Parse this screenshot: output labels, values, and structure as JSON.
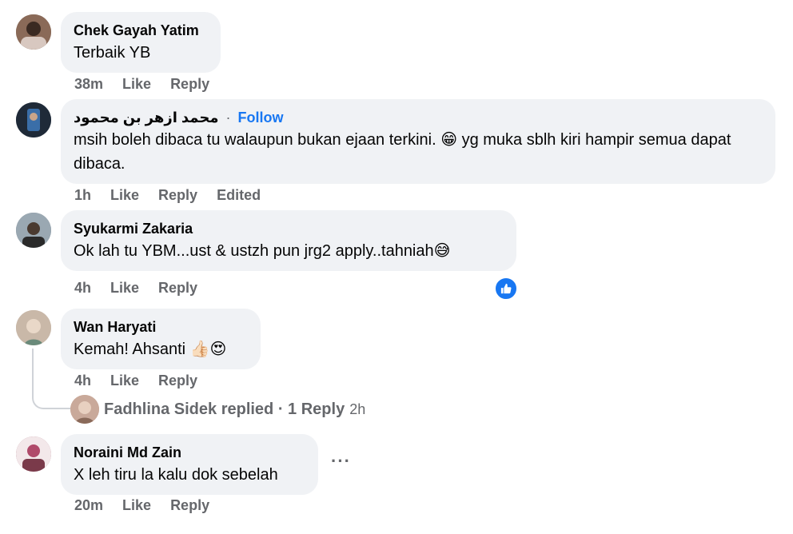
{
  "comments": [
    {
      "author": "Chek Gayah Yatim",
      "text": "Terbaik YB",
      "time": "38m",
      "like": "Like",
      "reply": "Reply",
      "avatar_color": "#7a5a4a"
    },
    {
      "author": "محمد ازهر بن محمود",
      "follow_sep": "·",
      "follow": "Follow",
      "text": "msih boleh dibaca tu walaupun bukan ejaan terkini. 😁 yg muka sblh kiri hampir semua dapat dibaca.",
      "time": "1h",
      "like": "Like",
      "reply": "Reply",
      "edited": "Edited",
      "avatar_color": "#2f3b4d"
    },
    {
      "author": "Syukarmi Zakaria",
      "text": "Ok lah tu YBM...ust & ustzh pun jrg2 apply..tahniah😅",
      "time": "4h",
      "like": "Like",
      "reply": "Reply",
      "avatar_color": "#6b7a86"
    },
    {
      "author": "Wan Haryati",
      "text": "Kemah! Ahsanti 👍🏻😍",
      "time": "4h",
      "like": "Like",
      "reply": "Reply",
      "avatar_color": "#b8a598"
    },
    {
      "author": "Noraini Md Zain",
      "text": "X leh tiru la kalu dok sebelah",
      "time": "20m",
      "like": "Like",
      "reply": "Reply",
      "more": "···",
      "avatar_color": "#9a5a6a"
    }
  ],
  "reply_summary": {
    "text": "Fadhlina Sidek replied · 1 Reply",
    "time": "2h"
  },
  "colors": {
    "bubble": "#f0f2f5",
    "secondary_text": "#65676b",
    "link": "#1877f2"
  }
}
